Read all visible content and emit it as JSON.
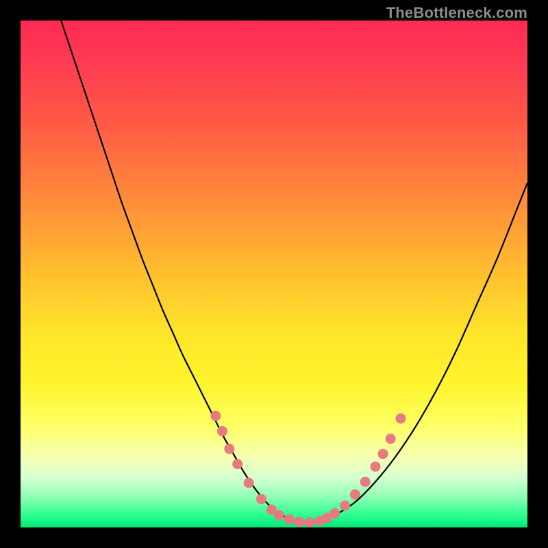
{
  "watermark": "TheBottleneck.com",
  "colors": {
    "black": "#000000",
    "curve": "#000000",
    "marker_fill": "#e77a7f",
    "marker_stroke": "#e77a7f"
  },
  "gradient_stops": [
    {
      "offset": 0.0,
      "color": "#ff2a55"
    },
    {
      "offset": 0.08,
      "color": "#ff3b52"
    },
    {
      "offset": 0.2,
      "color": "#ff5a46"
    },
    {
      "offset": 0.35,
      "color": "#ff8a3a"
    },
    {
      "offset": 0.5,
      "color": "#ffc02f"
    },
    {
      "offset": 0.62,
      "color": "#ffe62a"
    },
    {
      "offset": 0.72,
      "color": "#fff52e"
    },
    {
      "offset": 0.8,
      "color": "#ffff66"
    },
    {
      "offset": 0.86,
      "color": "#f6ffb0"
    },
    {
      "offset": 0.9,
      "color": "#d8ffd0"
    },
    {
      "offset": 0.94,
      "color": "#8fffb4"
    },
    {
      "offset": 0.975,
      "color": "#2dff8f"
    },
    {
      "offset": 1.0,
      "color": "#00e676"
    }
  ],
  "chart_data": {
    "type": "line",
    "title": "",
    "xlabel": "",
    "ylabel": "",
    "xlim": [
      0,
      100
    ],
    "ylim": [
      0,
      100
    ],
    "grid": false,
    "legend": false,
    "series": [
      {
        "name": "bottleneck-curve",
        "x": [
          8,
          10,
          12,
          14,
          16,
          18,
          20,
          22,
          24,
          26,
          28,
          30,
          32,
          34,
          36,
          38,
          40,
          42,
          44,
          46,
          48,
          50,
          52,
          54,
          56,
          58,
          60,
          62,
          66,
          70,
          74,
          78,
          82,
          86,
          90,
          94,
          98,
          100
        ],
        "y": [
          100,
          94,
          88,
          82,
          76,
          70,
          64,
          58.5,
          53,
          48,
          43,
          38.5,
          34,
          30,
          26,
          22,
          18,
          14.5,
          11,
          8,
          5.5,
          3.5,
          2.2,
          1.4,
          1.0,
          1.0,
          1.4,
          2.4,
          5,
          9,
          14,
          20,
          27,
          35,
          44,
          53,
          63,
          68
        ]
      }
    ],
    "markers": {
      "name": "highlight-points",
      "points": [
        {
          "x": 38.5,
          "y": 22
        },
        {
          "x": 39.8,
          "y": 19
        },
        {
          "x": 41.2,
          "y": 15.5
        },
        {
          "x": 42.8,
          "y": 12.5
        },
        {
          "x": 45.0,
          "y": 8.8
        },
        {
          "x": 47.5,
          "y": 5.6
        },
        {
          "x": 49.5,
          "y": 3.5
        },
        {
          "x": 51.0,
          "y": 2.4
        },
        {
          "x": 53.0,
          "y": 1.6
        },
        {
          "x": 55.0,
          "y": 1.1
        },
        {
          "x": 57.0,
          "y": 1.0
        },
        {
          "x": 59.0,
          "y": 1.3
        },
        {
          "x": 60.5,
          "y": 1.9
        },
        {
          "x": 62.0,
          "y": 2.8
        },
        {
          "x": 64.0,
          "y": 4.3
        },
        {
          "x": 66.0,
          "y": 6.5
        },
        {
          "x": 68.0,
          "y": 9.0
        },
        {
          "x": 70.0,
          "y": 12.0
        },
        {
          "x": 71.5,
          "y": 14.5
        },
        {
          "x": 73.0,
          "y": 17.5
        },
        {
          "x": 75.0,
          "y": 21.5
        }
      ]
    }
  }
}
